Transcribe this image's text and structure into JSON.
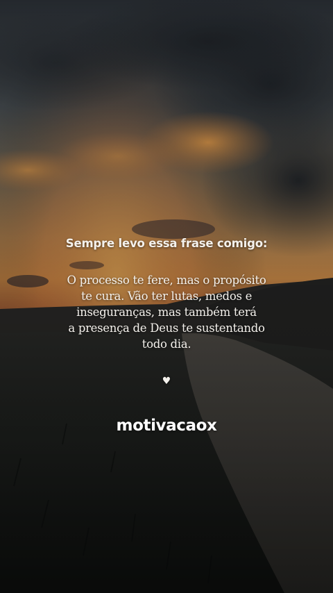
{
  "post": {
    "heading": "Sempre levo essa frase comigo:",
    "lines": [
      "O processo te fere, mas o propósito",
      "te cura. Vão ter lutas, medos e",
      "inseguranças, mas também terá",
      "a presença de Deus te sustentando",
      "todo dia."
    ],
    "heart": "♥",
    "handle": "motivacaox"
  },
  "colors": {
    "text": "#f4f1ec",
    "sunset": "#e79a45",
    "sky_dark": "#2e3338"
  }
}
